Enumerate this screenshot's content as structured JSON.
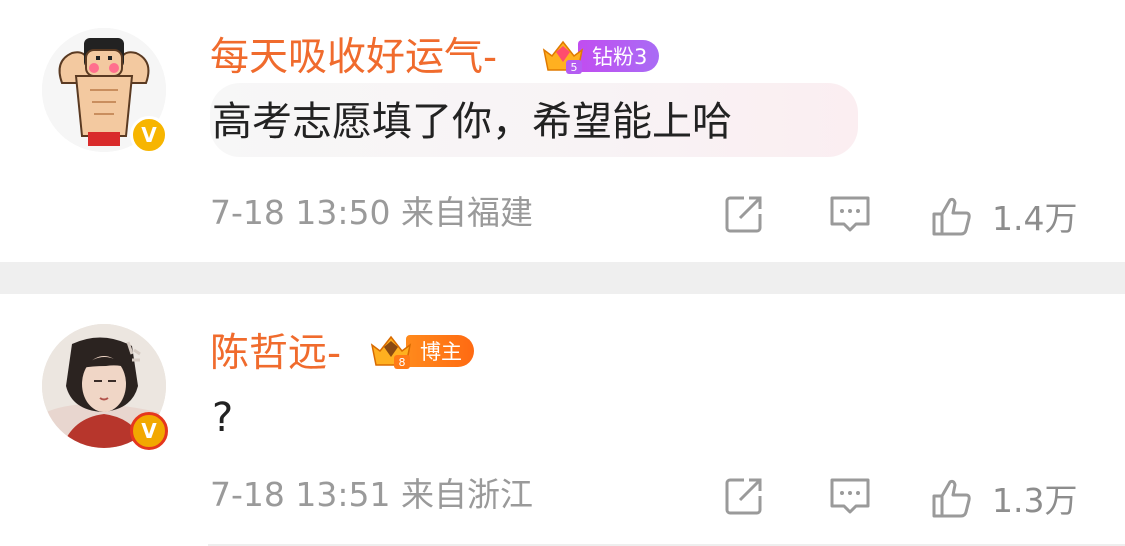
{
  "comments": [
    {
      "username": "每天吸收好运气-",
      "badge_label": "钻粉3",
      "badge_crown_level": "5",
      "text": "高考志愿填了你，希望能上哈",
      "time": "7-18 13:50",
      "location": "来自福建",
      "likes": "1.4万",
      "verify_mark": "V"
    },
    {
      "username": "陈哲远-",
      "badge_label": "博主",
      "badge_crown_level": "8",
      "text": "?",
      "time": "7-18 13:51",
      "location": "来自浙江",
      "likes": "1.3万",
      "verify_mark": "V"
    }
  ],
  "colors": {
    "username": "#f06b2d",
    "badge_fans": "#b45cf2",
    "badge_blogger": "#ff7a16",
    "verify": "#f7b500",
    "meta": "#9a9a9a"
  },
  "icons": [
    "share-icon",
    "comment-icon",
    "like-icon",
    "crown-icon"
  ]
}
